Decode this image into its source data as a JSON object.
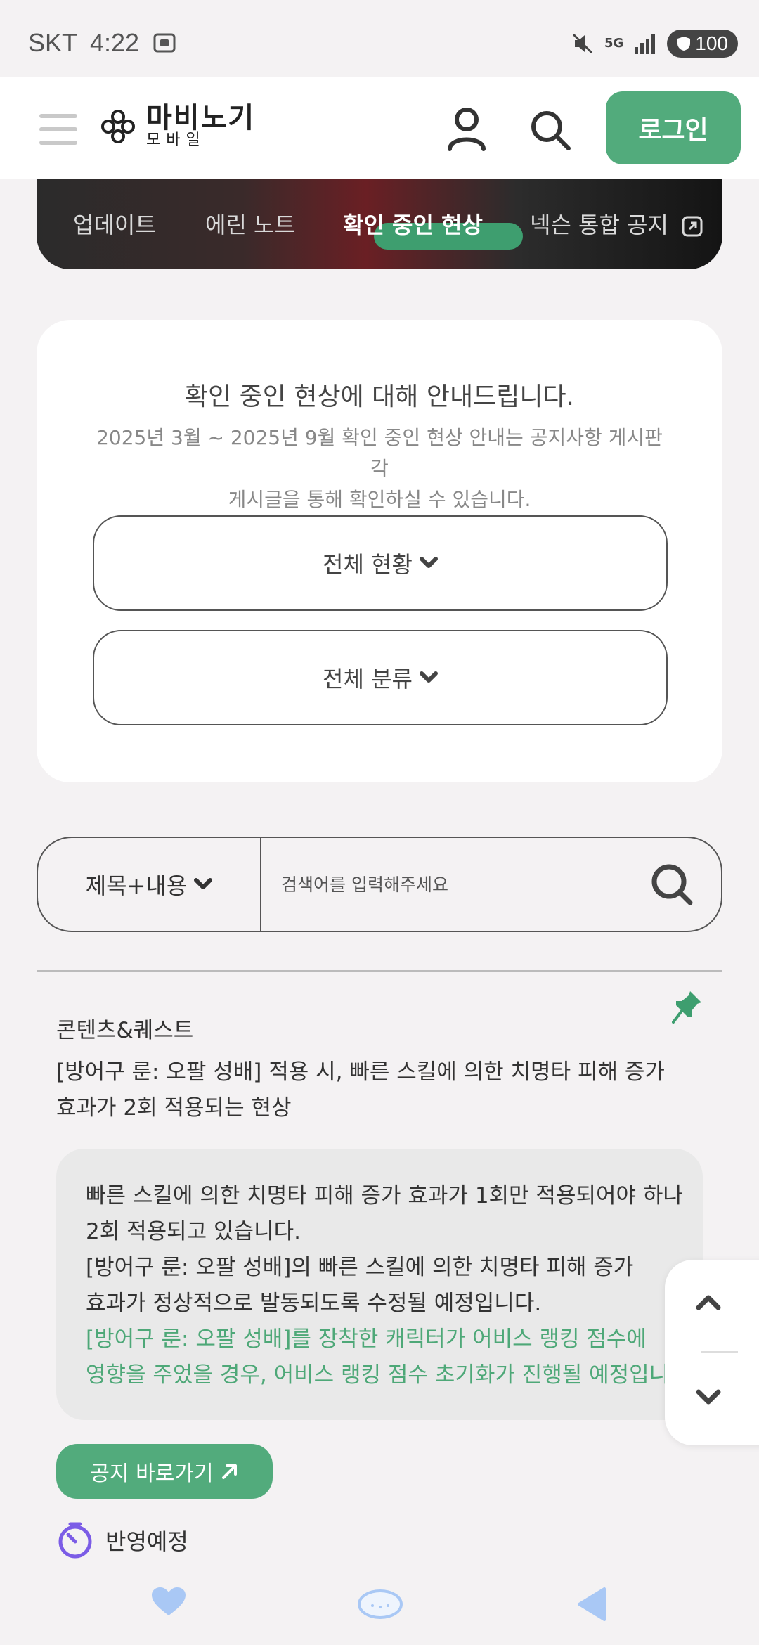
{
  "status_bar": {
    "carrier": "SKT",
    "time": "4:22",
    "network": "5G",
    "battery": "100"
  },
  "header": {
    "logo_main": "마비노기",
    "logo_sub": "모바일",
    "login_label": "로그인"
  },
  "tabs": [
    {
      "label": "업데이트",
      "active": false
    },
    {
      "label": "에린 노트",
      "active": false
    },
    {
      "label": "확인 중인 현상",
      "active": true
    },
    {
      "label": "넥슨 통합 공지",
      "active": false
    }
  ],
  "info_card": {
    "title": "확인 중인 현상에 대해 안내드립니다.",
    "desc_line1": "2025년 3월 ~ 2025년 9월 확인 중인 현상 안내는 공지사항 게시판 각",
    "desc_line2": "게시글을 통해 확인하실 수 있습니다.",
    "dropdown_status": "전체 현황",
    "dropdown_category": "전체 분류"
  },
  "search": {
    "type_label": "제목+내용",
    "placeholder": "검색어를 입력해주세요"
  },
  "post": {
    "category": "콘텐츠&퀘스트",
    "title_line1": "[방어구 룬: 오팔 성배] 적용 시, 빠른 스킬에 의한 치명타 피해 증가",
    "title_line2": "효과가 2회 적용되는 현상",
    "body": [
      {
        "text": "빠른 스킬에 의한 치명타 피해 증가 효과가 1회만 적용되어야 하나",
        "green": false
      },
      {
        "text": "2회 적용되고 있습니다.",
        "green": false
      },
      {
        "text": "[방어구 룬: 오팔 성배]의 빠른 스킬에 의한 치명타 피해 증가",
        "green": false
      },
      {
        "text": "효과가 정상적으로 발동되도록 수정될 예정입니다.",
        "green": false
      },
      {
        "text": "[방어구 룬: 오팔 성배]를 장착한 캐릭터가 어비스 랭킹 점수에",
        "green": true
      },
      {
        "text": "영향을 주었을 경우, 어비스 랭킹 점수 초기화가 진행될 예정입니다.",
        "green": true
      }
    ],
    "notice_button": "공지 바로가기",
    "status_label": "반영예정"
  },
  "colors": {
    "accent_green": "#52ab7c",
    "text_green": "#4ea878",
    "status_purple": "#7b5ce6"
  },
  "icons": [
    "menu-icon",
    "logo-icon",
    "user-icon",
    "search-icon",
    "external-link-icon",
    "chevron-down-icon",
    "pin-icon",
    "arrow-up-right-icon",
    "timer-icon",
    "chevron-up-icon",
    "heart-icon",
    "bread-icon",
    "back-icon"
  ]
}
